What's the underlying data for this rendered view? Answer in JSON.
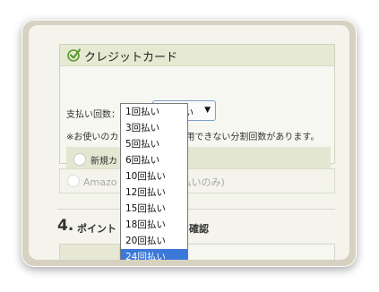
{
  "credit_card": {
    "title": "クレジットカード",
    "installments_label": "支払い回数：",
    "installments_value": "1回払い",
    "note": "※お使いのカ",
    "note_tail": "用できない分割回数があります。",
    "new_card_label": "新規カ"
  },
  "amazon": {
    "label_start": "Amazo",
    "label_tail": "払いのみ)"
  },
  "section4": {
    "number": "4.",
    "title_start": "ポイント",
    "title_tail": "の確認"
  },
  "dropdown": {
    "options": [
      "1回払い",
      "3回払い",
      "5回払い",
      "6回払い",
      "10回払い",
      "12回払い",
      "15回払い",
      "18回払い",
      "20回払い",
      "24回払い"
    ],
    "highlighted": "24回払い"
  },
  "colors": {
    "header_bg": "#e6ead2",
    "check_green": "#5b9a2f",
    "highlight": "#3c78d8"
  },
  "icons": {
    "check": "checkmark-circle-icon",
    "select_arrow": "triangle-down-icon"
  }
}
